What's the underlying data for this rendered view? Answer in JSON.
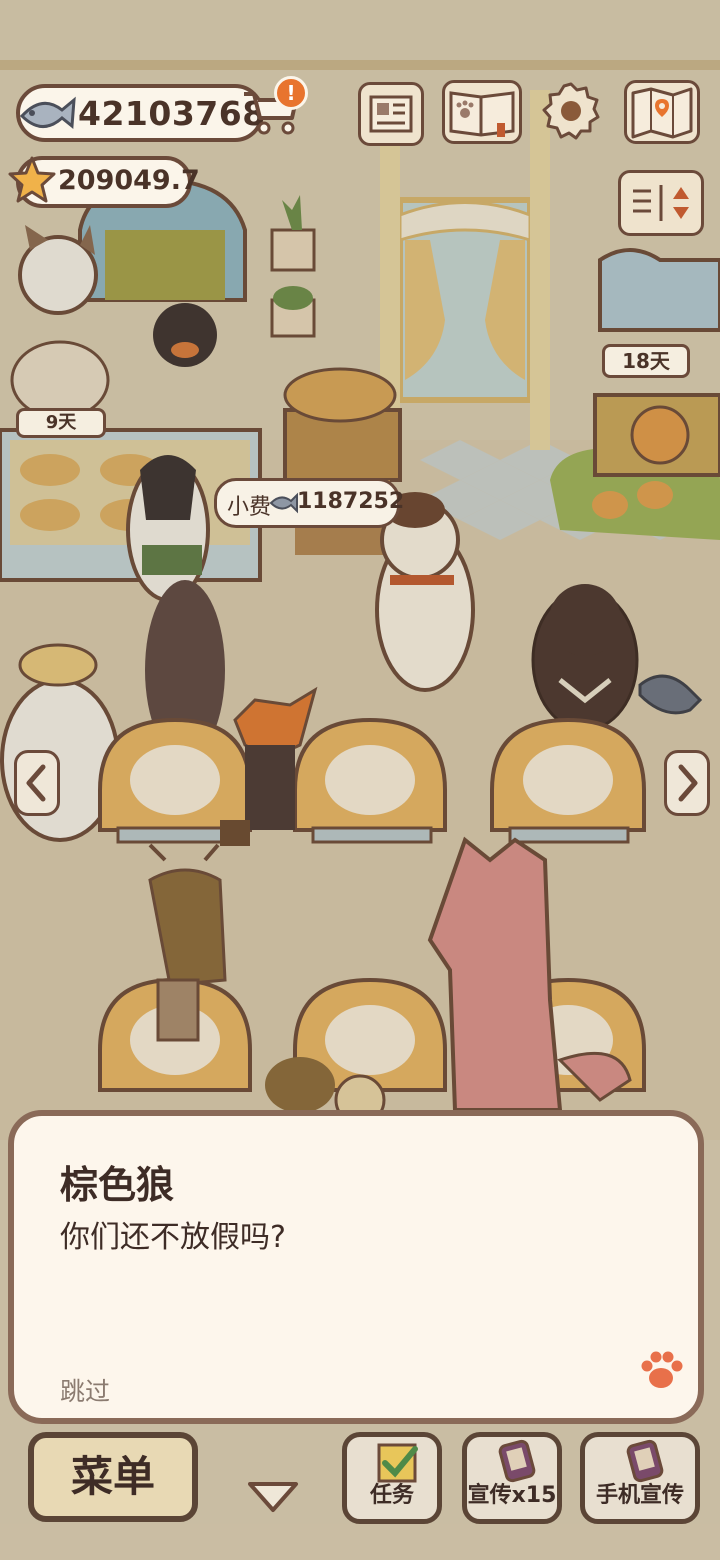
{
  "hud": {
    "fish_count": "42103768",
    "star_count": "209049.7",
    "notification_badge": "!"
  },
  "scene": {
    "tip_label": "小费",
    "tip_value": "1187252",
    "left_display_days": "9天",
    "right_display_days": "18天"
  },
  "dialog": {
    "speaker": "棕色狼",
    "text": "你们还不放假吗?",
    "skip_label": "跳过"
  },
  "bottom_bar": {
    "menu_label": "菜单",
    "tasks_label": "任务",
    "promote_label": "宣传x15",
    "phone_promote_label": "手机宣传"
  },
  "colors": {
    "outline": "#6b4a3a",
    "dialog_bg": "#fdf6ec",
    "paw_accent": "#e8704a",
    "badge_orange": "#e8742e"
  }
}
